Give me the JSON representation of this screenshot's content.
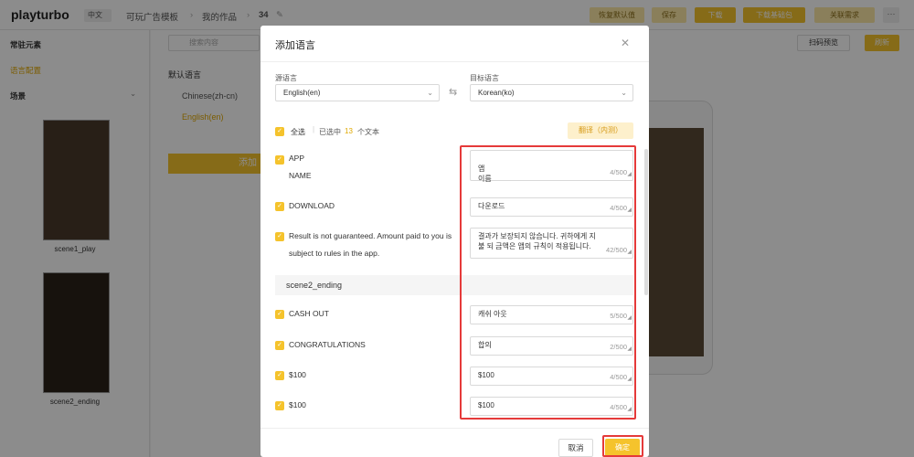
{
  "app": {
    "logo": "playturbo",
    "lang": "中文",
    "breadcrumb": [
      "可玩广告模板",
      "我的作品",
      "34"
    ],
    "top_buttons": [
      "恢复默认值",
      "保存",
      "下载",
      "下载基础包",
      "关联需求"
    ],
    "more": "···"
  },
  "left_panel": {
    "common_elements": "常驻元素",
    "language_config": "语言配置",
    "scenes": "场景",
    "scene_labels": [
      "scene1_play",
      "scene2_ending"
    ]
  },
  "mid_panel": {
    "search_placeholder": "搜索内容",
    "default_lang_label": "默认语言",
    "options": [
      "Chinese(zh-cn)",
      "English(en)"
    ],
    "add_label": "添加",
    "scan_preview": "扫码预览",
    "refresh": "刷新"
  },
  "modal": {
    "title": "添加语言",
    "source_label": "源语言",
    "target_label": "目标语言",
    "source_value": "English(en)",
    "target_value": "Korean(ko)",
    "select_all": "全选",
    "selected_prefix": "已选中",
    "selected_count": "13",
    "selected_suffix": "个文本",
    "translate_btn": "翻译（内测）",
    "rows": [
      {
        "source": "APP\nNAME",
        "target": "앱\n이름",
        "count": "4/500"
      },
      {
        "source": "DOWNLOAD",
        "target": "다운로드",
        "count": "4/500"
      },
      {
        "source": "Result is not guaranteed. Amount paid to you is subject to rules in the app.",
        "target": "결과가 보장되지 않습니다. 귀하에게 지불 되 금액은 앱의 규칙이 적용됩니다.",
        "count": "42/500"
      },
      {
        "source": "CASH OUT",
        "target": "캐쉬 아웃",
        "count": "5/500"
      },
      {
        "source": "CONGRATULATIONS",
        "target": "합의",
        "count": "2/500"
      },
      {
        "source": "$100",
        "target": "$100",
        "count": "4/500"
      },
      {
        "source": "$100",
        "target": "$100",
        "count": "4/500"
      }
    ],
    "section_label": "scene2_ending",
    "cancel": "取消",
    "confirm": "确定"
  }
}
